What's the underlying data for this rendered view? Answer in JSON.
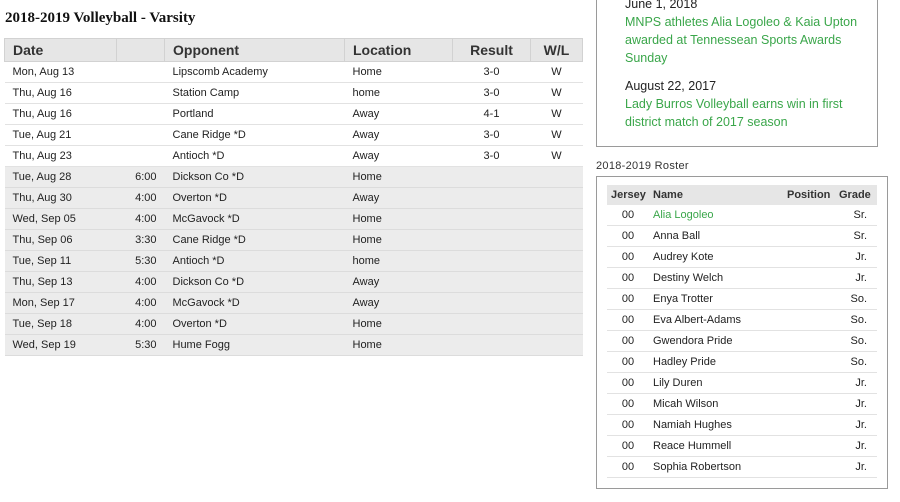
{
  "schedule": {
    "title": "2018-2019 Volleyball - Varsity",
    "headers": {
      "date": "Date",
      "time": "",
      "opponent": "Opponent",
      "location": "Location",
      "result": "Result",
      "wl": "W/L"
    },
    "rows": [
      {
        "date": "Mon, Aug 13",
        "time": "",
        "opponent": "Lipscomb Academy",
        "location": "Home",
        "result": "3-0",
        "wl": "W",
        "played": true
      },
      {
        "date": "Thu, Aug 16",
        "time": "",
        "opponent": "Station Camp",
        "location": "home",
        "result": "3-0",
        "wl": "W",
        "played": true
      },
      {
        "date": "Thu, Aug 16",
        "time": "",
        "opponent": "Portland",
        "location": "Away",
        "result": "4-1",
        "wl": "W",
        "played": true
      },
      {
        "date": "Tue, Aug 21",
        "time": "",
        "opponent": "Cane Ridge *D",
        "location": "Away",
        "result": "3-0",
        "wl": "W",
        "played": true
      },
      {
        "date": "Thu, Aug 23",
        "time": "",
        "opponent": "Antioch *D",
        "location": "Away",
        "result": "3-0",
        "wl": "W",
        "played": true
      },
      {
        "date": "Tue, Aug 28",
        "time": "6:00",
        "opponent": "Dickson Co *D",
        "location": "Home",
        "result": "",
        "wl": "",
        "played": false
      },
      {
        "date": "Thu, Aug 30",
        "time": "4:00",
        "opponent": "Overton *D",
        "location": "Away",
        "result": "",
        "wl": "",
        "played": false
      },
      {
        "date": "Wed, Sep 05",
        "time": "4:00",
        "opponent": "McGavock *D",
        "location": "Home",
        "result": "",
        "wl": "",
        "played": false
      },
      {
        "date": "Thu, Sep 06",
        "time": "3:30",
        "opponent": "Cane Ridge *D",
        "location": "Home",
        "result": "",
        "wl": "",
        "played": false
      },
      {
        "date": "Tue, Sep 11",
        "time": "5:30",
        "opponent": "Antioch *D",
        "location": "home",
        "result": "",
        "wl": "",
        "played": false
      },
      {
        "date": "Thu, Sep 13",
        "time": "4:00",
        "opponent": "Dickson Co *D",
        "location": "Away",
        "result": "",
        "wl": "",
        "played": false
      },
      {
        "date": "Mon, Sep 17",
        "time": "4:00",
        "opponent": "McGavock *D",
        "location": "Away",
        "result": "",
        "wl": "",
        "played": false
      },
      {
        "date": "Tue, Sep 18",
        "time": "4:00",
        "opponent": "Overton *D",
        "location": "Home",
        "result": "",
        "wl": "",
        "played": false
      },
      {
        "date": "Wed, Sep 19",
        "time": "5:30",
        "opponent": "Hume Fogg",
        "location": "Home",
        "result": "",
        "wl": "",
        "played": false
      }
    ]
  },
  "news": {
    "items": [
      {
        "date": "June 1, 2018",
        "headline": "MNPS athletes Alia Logoleo & Kaia Upton awarded at Tennessean Sports Awards Sunday"
      },
      {
        "date": "August 22, 2017",
        "headline": "Lady Burros Volleyball earns win in first district match of 2017 season"
      }
    ]
  },
  "roster": {
    "title": "2018-2019 Roster",
    "headers": {
      "jersey": "Jersey",
      "name": "Name",
      "position": "Position",
      "grade": "Grade"
    },
    "rows": [
      {
        "jersey": "00",
        "name": "Alia Logoleo",
        "position": "",
        "grade": "Sr.",
        "link": true
      },
      {
        "jersey": "00",
        "name": "Anna Ball",
        "position": "",
        "grade": "Sr.",
        "link": false
      },
      {
        "jersey": "00",
        "name": "Audrey Kote",
        "position": "",
        "grade": "Jr.",
        "link": false
      },
      {
        "jersey": "00",
        "name": "Destiny Welch",
        "position": "",
        "grade": "Jr.",
        "link": false
      },
      {
        "jersey": "00",
        "name": "Enya Trotter",
        "position": "",
        "grade": "So.",
        "link": false
      },
      {
        "jersey": "00",
        "name": "Eva Albert-Adams",
        "position": "",
        "grade": "So.",
        "link": false
      },
      {
        "jersey": "00",
        "name": "Gwendora Pride",
        "position": "",
        "grade": "So.",
        "link": false
      },
      {
        "jersey": "00",
        "name": "Hadley Pride",
        "position": "",
        "grade": "So.",
        "link": false
      },
      {
        "jersey": "00",
        "name": "Lily Duren",
        "position": "",
        "grade": "Jr.",
        "link": false
      },
      {
        "jersey": "00",
        "name": "Micah Wilson",
        "position": "",
        "grade": "Jr.",
        "link": false
      },
      {
        "jersey": "00",
        "name": "Namiah Hughes",
        "position": "",
        "grade": "Jr.",
        "link": false
      },
      {
        "jersey": "00",
        "name": "Reace Hummell",
        "position": "",
        "grade": "Jr.",
        "link": false
      },
      {
        "jersey": "00",
        "name": "Sophia Robertson",
        "position": "",
        "grade": "Jr.",
        "link": false
      }
    ]
  },
  "colors": {
    "link": "#3aa64a",
    "header_bg": "#e6e6e6",
    "future_row_bg": "#ececec"
  }
}
